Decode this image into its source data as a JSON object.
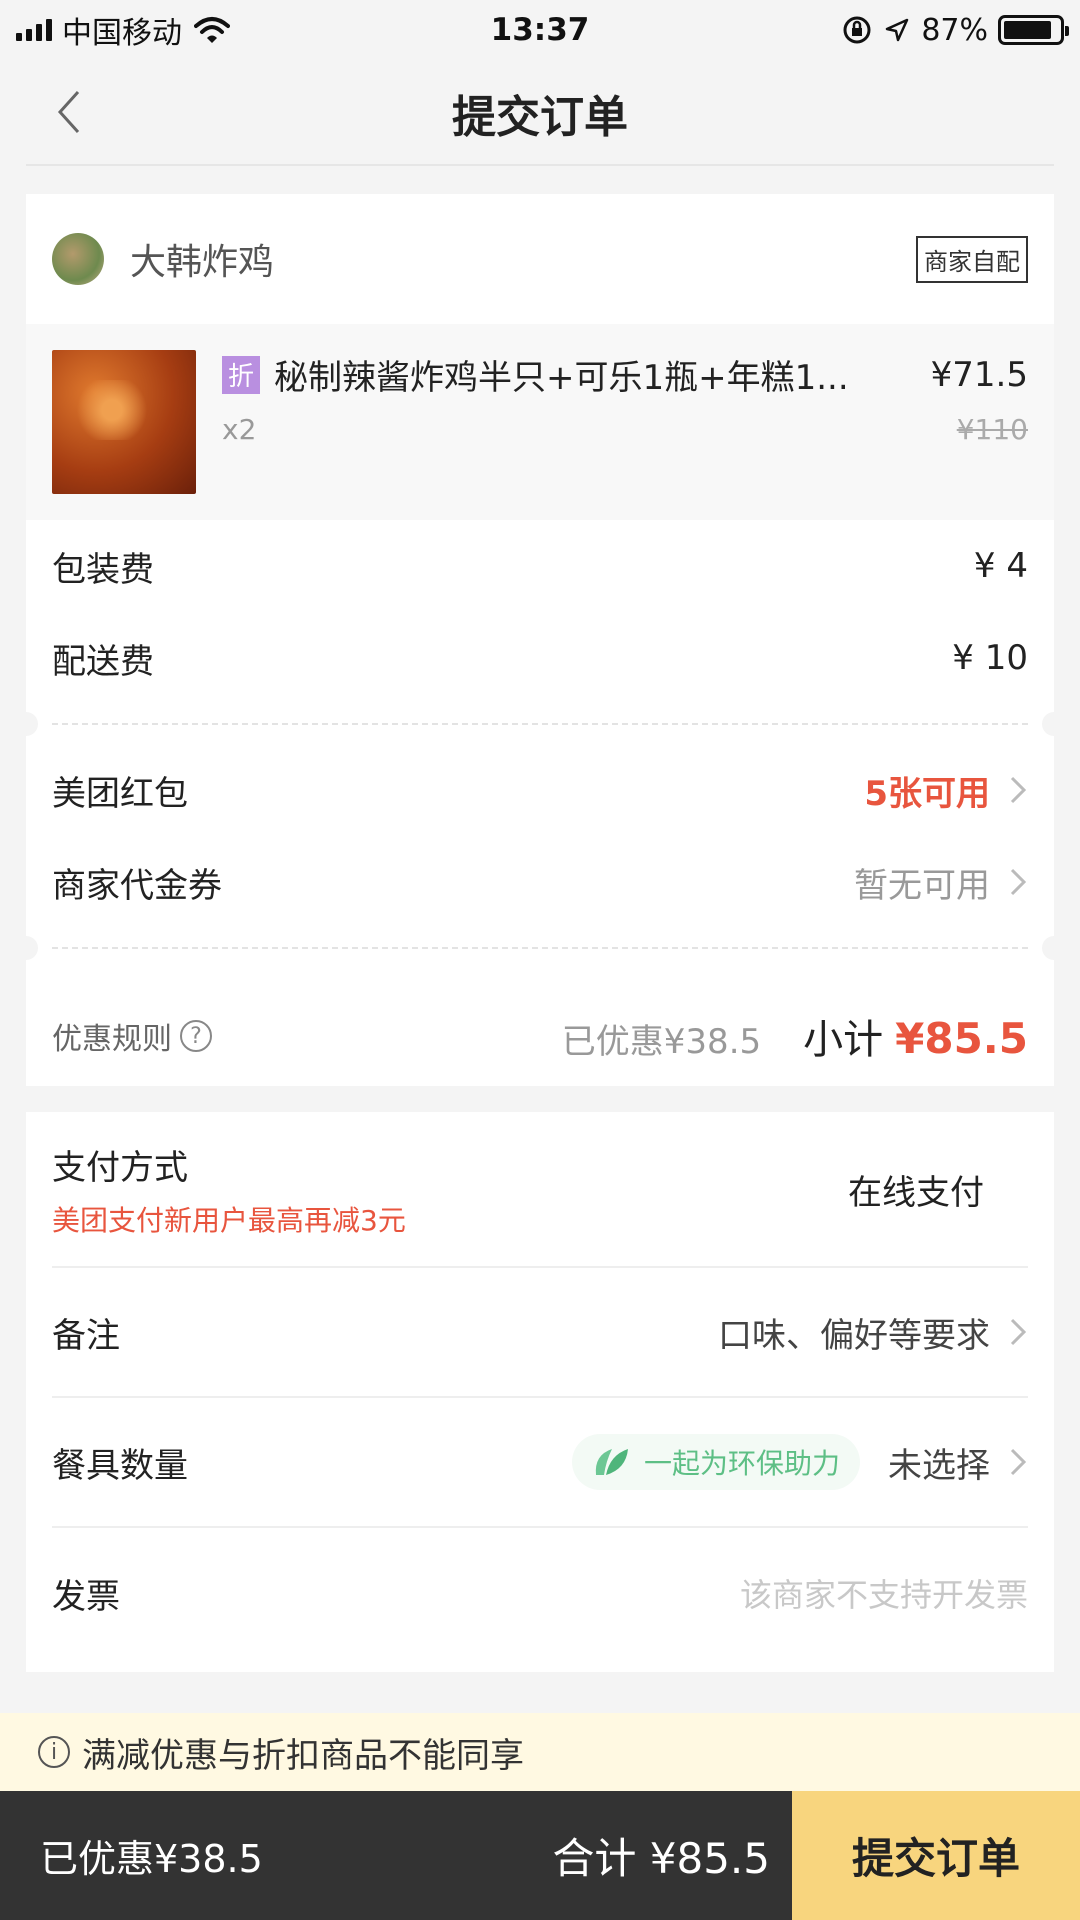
{
  "status_bar": {
    "carrier": "中国移动",
    "time": "13:37",
    "battery": "87%",
    "battery_level": 0.87
  },
  "nav": {
    "title": "提交订单"
  },
  "shop": {
    "name": "大韩炸鸡",
    "tag": "商家自配"
  },
  "item": {
    "badge": "折",
    "name": "秘制辣酱炸鸡半只+可乐1瓶+年糕1...",
    "price": "¥71.5",
    "qty": "x2",
    "original_price": "¥110"
  },
  "fees": [
    {
      "label": "包装费",
      "value": "¥ 4"
    },
    {
      "label": "配送费",
      "value": "¥ 10"
    }
  ],
  "coupons": {
    "red_packet": {
      "label": "美团红包",
      "value": "5张可用"
    },
    "voucher": {
      "label": "商家代金券",
      "value": "暂无可用"
    }
  },
  "summary": {
    "rule_label": "优惠规则",
    "rule_icon": "?",
    "saved": "已优惠¥38.5",
    "subtotal_label": "小计",
    "subtotal": "¥85.5"
  },
  "payment": {
    "label": "支付方式",
    "promo": "美团支付新用户最高再减3元",
    "value": "在线支付"
  },
  "remark": {
    "label": "备注",
    "placeholder": "口味、偏好等要求"
  },
  "tableware": {
    "label": "餐具数量",
    "eco_text": "一起为环保助力",
    "value": "未选择"
  },
  "invoice": {
    "label": "发票",
    "value": "该商家不支持开发票"
  },
  "notice": {
    "icon": "i",
    "text": "满减优惠与折扣商品不能同享"
  },
  "bottom_bar": {
    "saved": "已优惠¥38.5",
    "total": "合计 ¥85.5",
    "submit": "提交订单"
  },
  "colors": {
    "accent_red": "#e8553e",
    "submit_yellow": "#f8d57e",
    "eco_green": "#5dbf85",
    "dark_bar": "#333333"
  }
}
